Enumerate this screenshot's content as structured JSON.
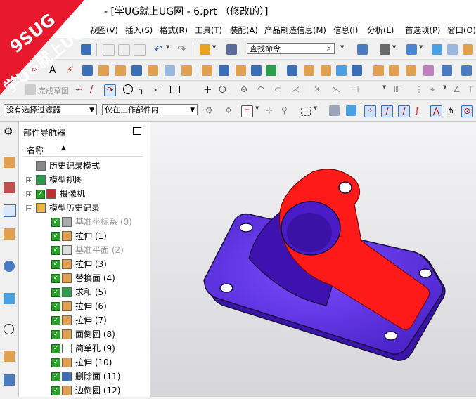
{
  "window": {
    "title": "- [学UG就上UG网 - 6.prt （修改的）]"
  },
  "logo": {
    "brand": "9SUG",
    "slogan": "学UG就上UG网"
  },
  "menubar": {
    "items": [
      "视图(V)",
      "插入(S)",
      "格式(R)",
      "工具(T)",
      "装配(A)",
      "产品制造信息(M)",
      "信息(I)",
      "分析(L)",
      "首选项(P)",
      "窗口(O)"
    ]
  },
  "toolbar": {
    "command_finder_placeholder": "查找命令",
    "sketch_finish_label": "完成草图",
    "filter_label": "没有选择过滤器",
    "scope_label": "仅在工作部件内"
  },
  "navigator": {
    "title": "部件导航器",
    "column_header": "名称",
    "tree": [
      {
        "label": "历史记录模式",
        "indent": 0,
        "expander": "",
        "checkbox": false,
        "dim": false,
        "icon": "clock-icon"
      },
      {
        "label": "模型视图",
        "indent": 0,
        "expander": "+",
        "checkbox": false,
        "dim": false,
        "icon": "model-view-icon"
      },
      {
        "label": "摄像机",
        "indent": 0,
        "expander": "+",
        "checkbox": true,
        "dim": false,
        "icon": "camera-icon"
      },
      {
        "label": "模型历史记录",
        "indent": 0,
        "expander": "-",
        "checkbox": false,
        "dim": false,
        "icon": "folder-icon"
      },
      {
        "label": "基准坐标系 (0)",
        "indent": 1,
        "expander": "",
        "checkbox": true,
        "dim": true,
        "icon": "datum-csys-icon"
      },
      {
        "label": "拉伸 (1)",
        "indent": 1,
        "expander": "",
        "checkbox": true,
        "dim": false,
        "icon": "extrude-icon"
      },
      {
        "label": "基准平面 (2)",
        "indent": 1,
        "expander": "",
        "checkbox": true,
        "dim": true,
        "icon": "datum-plane-icon"
      },
      {
        "label": "拉伸 (3)",
        "indent": 1,
        "expander": "",
        "checkbox": true,
        "dim": false,
        "icon": "extrude-icon"
      },
      {
        "label": "替换面 (4)",
        "indent": 1,
        "expander": "",
        "checkbox": true,
        "dim": false,
        "icon": "replace-face-icon"
      },
      {
        "label": "求和 (5)",
        "indent": 1,
        "expander": "",
        "checkbox": true,
        "dim": false,
        "icon": "unite-icon"
      },
      {
        "label": "拉伸 (6)",
        "indent": 1,
        "expander": "",
        "checkbox": true,
        "dim": false,
        "icon": "extrude-icon"
      },
      {
        "label": "拉伸 (7)",
        "indent": 1,
        "expander": "",
        "checkbox": true,
        "dim": false,
        "icon": "extrude-icon"
      },
      {
        "label": "面倒圆 (8)",
        "indent": 1,
        "expander": "",
        "checkbox": true,
        "dim": false,
        "icon": "face-blend-icon"
      },
      {
        "label": "简单孔 (9)",
        "indent": 1,
        "expander": "",
        "checkbox": true,
        "dim": false,
        "icon": "simple-hole-icon"
      },
      {
        "label": "拉伸 (10)",
        "indent": 1,
        "expander": "",
        "checkbox": true,
        "dim": false,
        "icon": "extrude-icon"
      },
      {
        "label": "删除面 (11)",
        "indent": 1,
        "expander": "",
        "checkbox": true,
        "dim": false,
        "icon": "delete-face-icon"
      },
      {
        "label": "边倒圆 (12)",
        "indent": 1,
        "expander": "",
        "checkbox": true,
        "dim": false,
        "icon": "edge-blend-icon"
      }
    ]
  },
  "model": {
    "base_color": "#6633ee",
    "arm_color": "#ff1a1a",
    "edge_color": "#1a0f3a"
  },
  "colors": {
    "logo_red": "#e8192c",
    "toolbar_bg": "#f0f0f0"
  }
}
